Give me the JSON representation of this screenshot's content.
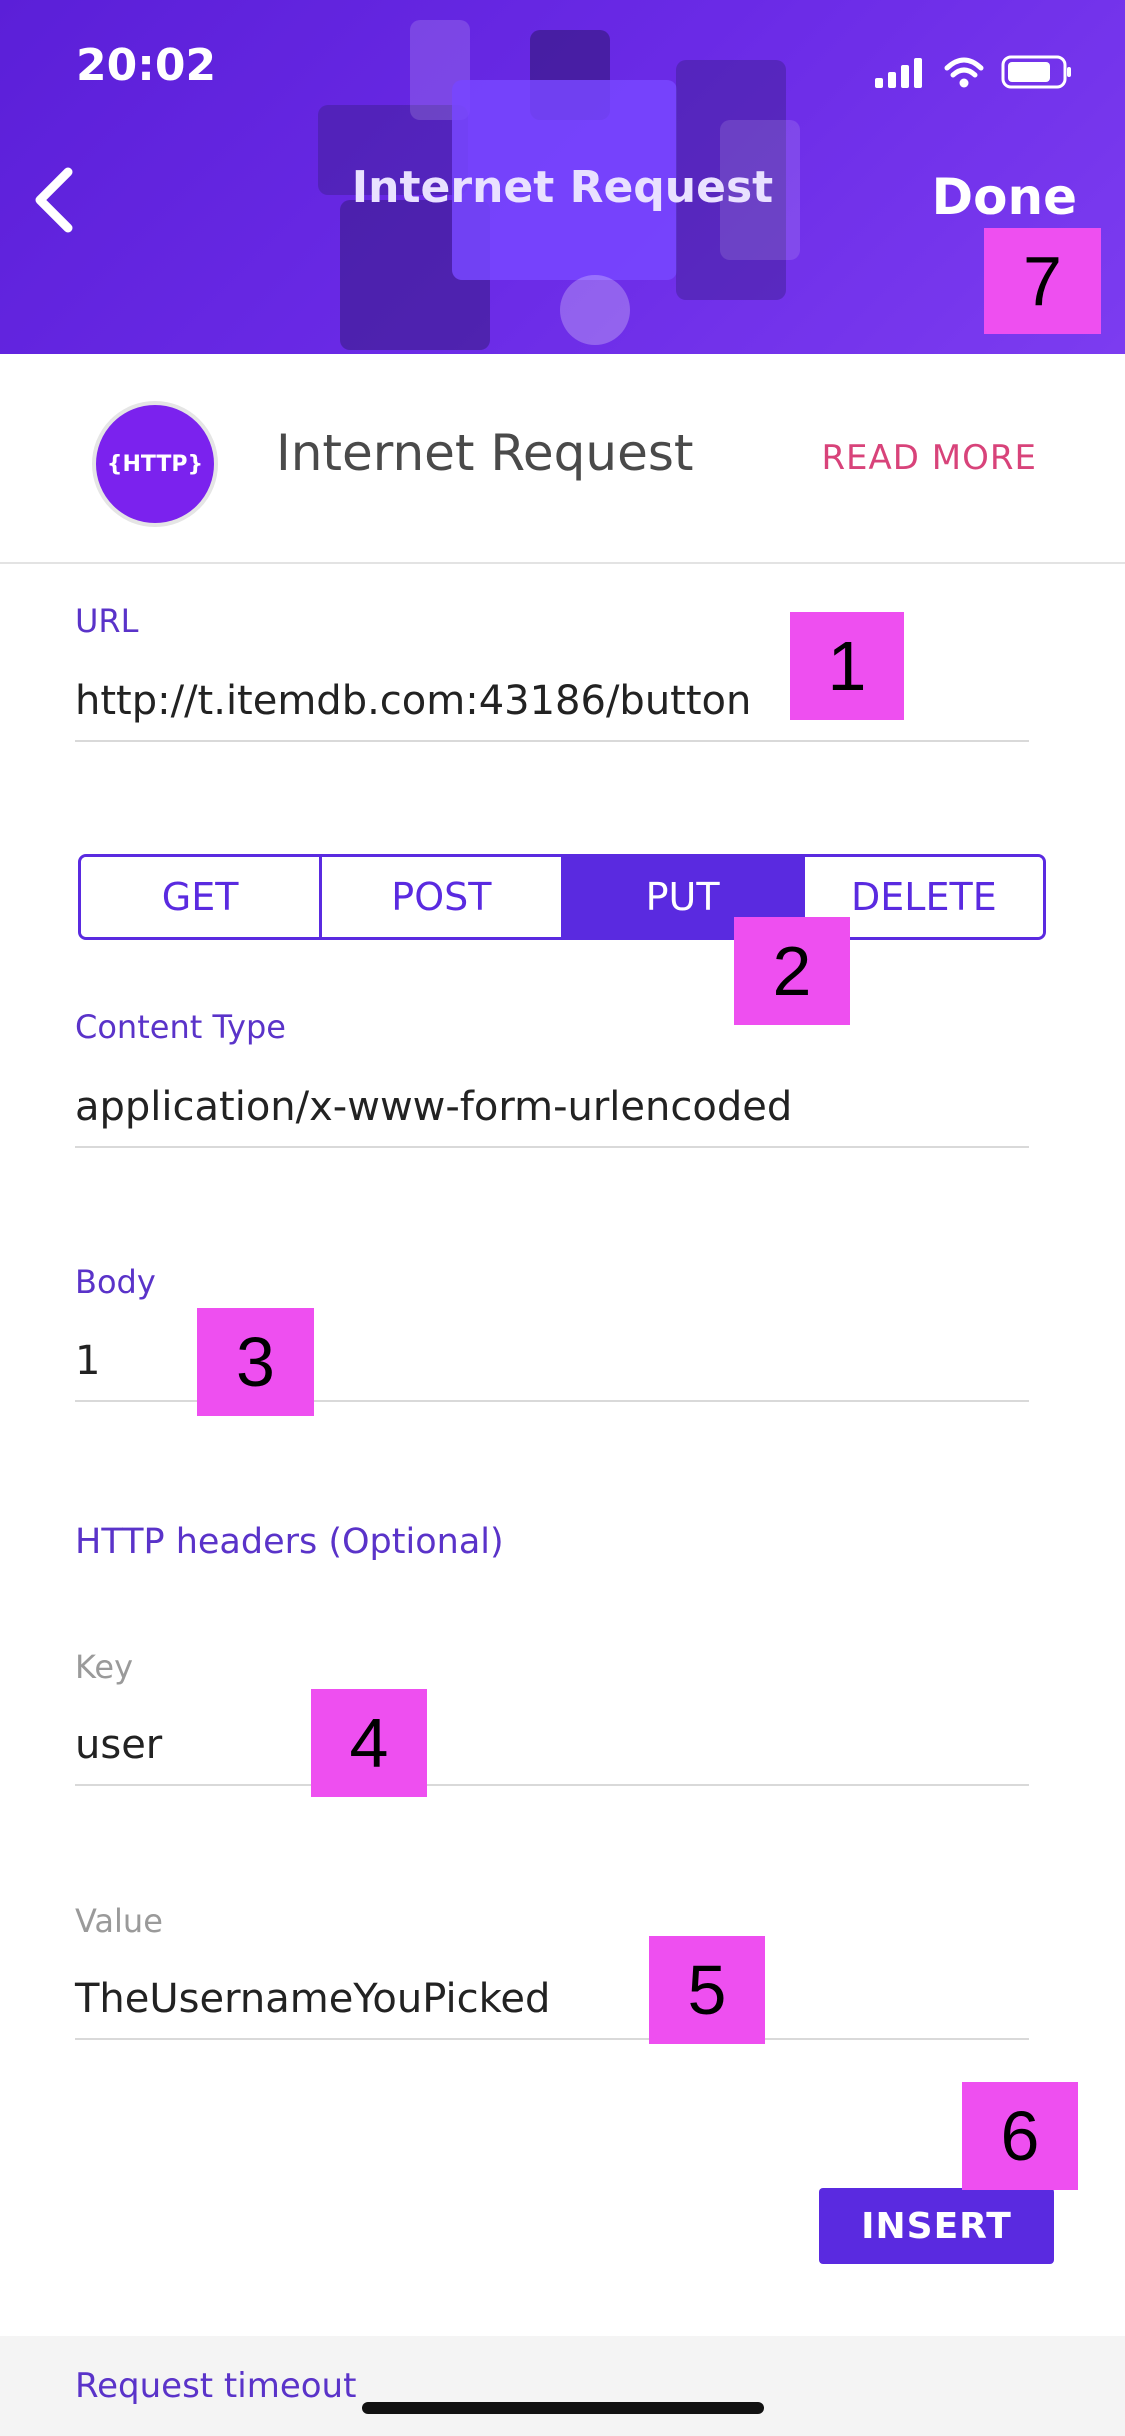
{
  "status_bar": {
    "time": "20:02"
  },
  "nav": {
    "title": "Internet Request",
    "done_label": "Done"
  },
  "action_info": {
    "badge_text": "{HTTP}",
    "title": "Internet Request",
    "read_more_label": "READ MORE"
  },
  "url": {
    "label": "URL",
    "value": "http://t.itemdb.com:43186/button"
  },
  "method": {
    "options": [
      "GET",
      "POST",
      "PUT",
      "DELETE"
    ],
    "selected": "PUT"
  },
  "content_type": {
    "label": "Content Type",
    "value": "application/x-www-form-urlencoded"
  },
  "body": {
    "label": "Body",
    "value": "1"
  },
  "headers": {
    "section_label": "HTTP headers (Optional)",
    "key_label": "Key",
    "key_value": "user",
    "value_label": "Value",
    "value_value": "TheUsernameYouPicked",
    "insert_label": "INSERT"
  },
  "timeout": {
    "label": "Request timeout"
  },
  "markers": [
    "1",
    "2",
    "3",
    "4",
    "5",
    "6",
    "7"
  ],
  "colors": {
    "accent": "#5a2ae0",
    "header": "#6a2ae6",
    "marker": "#ee4ff0",
    "read_more": "#d8437a"
  }
}
